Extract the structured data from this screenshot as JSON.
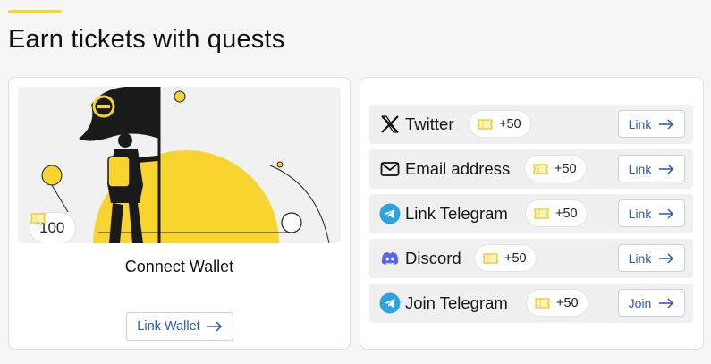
{
  "page": {
    "title": "Earn tickets with quests"
  },
  "colors": {
    "accent": "#f8d42f",
    "link": "#2d56b8",
    "telegram": "#2aa3df",
    "discord": "#5865f2"
  },
  "featured": {
    "reward": "100",
    "title": "Connect Wallet",
    "button_label": "Link Wallet"
  },
  "quests": [
    {
      "icon": "x-icon",
      "label": "Twitter",
      "points": "+50",
      "button_label": "Link"
    },
    {
      "icon": "envelope-icon",
      "label": "Email address",
      "points": "+50",
      "button_label": "Link"
    },
    {
      "icon": "telegram-icon",
      "label": "Link Telegram",
      "points": "+50",
      "button_label": "Link"
    },
    {
      "icon": "discord-icon",
      "label": "Discord",
      "points": "+50",
      "button_label": "Link"
    },
    {
      "icon": "telegram-icon",
      "label": "Join Telegram",
      "points": "+50",
      "button_label": "Join"
    }
  ]
}
